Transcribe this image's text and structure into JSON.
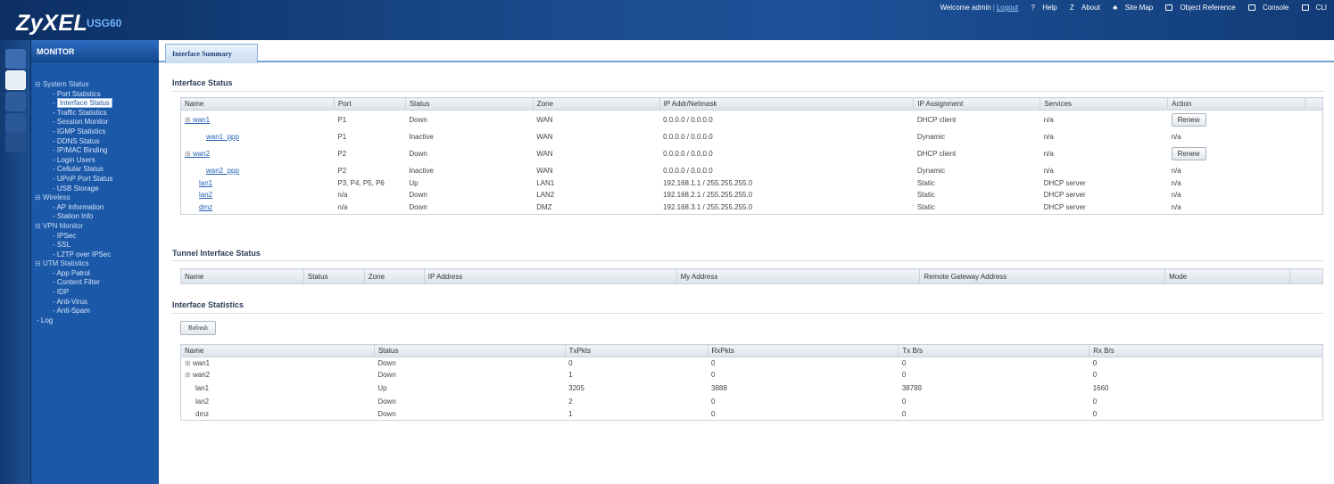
{
  "header": {
    "logo": "ZyXEL",
    "model": "USG60",
    "welcome": "Welcome admin",
    "separator": "|",
    "logout": "Logout",
    "links": [
      "Help",
      "About",
      "Site Map",
      "Object Reference",
      "Console",
      "CLI"
    ]
  },
  "sidebar": {
    "title": "MONITOR",
    "groups": [
      {
        "label": "System Status",
        "items": [
          "Port Statistics",
          "Interface Status",
          "Traffic Statistics",
          "Session Monitor",
          "IGMP Statistics",
          "DDNS Status",
          "IP/MAC Binding",
          "Login Users",
          "Cellular Status",
          "UPnP Port Status",
          "USB Storage"
        ]
      },
      {
        "label": "Wireless",
        "items": [
          "AP Information",
          "Station Info"
        ]
      },
      {
        "label": "VPN Monitor",
        "items": [
          "IPSec",
          "SSL",
          "L2TP over IPSec"
        ]
      },
      {
        "label": "UTM Statistics",
        "items": [
          "App Patrol",
          "Content Filter",
          "IDP",
          "Anti-Virus",
          "Anti-Spam"
        ]
      }
    ],
    "log": "Log"
  },
  "tab": {
    "label": "Interface Summary"
  },
  "interface_status": {
    "title": "Interface Status",
    "columns": [
      "Name",
      "Port",
      "Status",
      "Zone",
      "IP Addr/Netmask",
      "IP Assignment",
      "Services",
      "Action"
    ],
    "rows": [
      {
        "name": "wan1",
        "port": "P1",
        "status": "Down",
        "zone": "WAN",
        "ip": "0.0.0.0 / 0.0.0.0",
        "assign": "DHCP client",
        "services": "n/a",
        "action": "Renew"
      },
      {
        "name": "wan1_ppp",
        "port": "P1",
        "status": "Inactive",
        "zone": "WAN",
        "ip": "0.0.0.0 / 0.0.0.0",
        "assign": "Dynamic",
        "services": "n/a",
        "action": "n/a"
      },
      {
        "name": "wan2",
        "port": "P2",
        "status": "Down",
        "zone": "WAN",
        "ip": "0.0.0.0 / 0.0.0.0",
        "assign": "DHCP client",
        "services": "n/a",
        "action": "Renew"
      },
      {
        "name": "wan2_ppp",
        "port": "P2",
        "status": "Inactive",
        "zone": "WAN",
        "ip": "0.0.0.0 / 0.0.0.0",
        "assign": "Dynamic",
        "services": "n/a",
        "action": "n/a"
      },
      {
        "name": "lan1",
        "port": "P3, P4, P5, P6",
        "status": "Up",
        "zone": "LAN1",
        "ip": "192.168.1.1 / 255.255.255.0",
        "assign": "Static",
        "services": "DHCP server",
        "action": "n/a"
      },
      {
        "name": "lan2",
        "port": "n/a",
        "status": "Down",
        "zone": "LAN2",
        "ip": "192.168.2.1 / 255.255.255.0",
        "assign": "Static",
        "services": "DHCP server",
        "action": "n/a"
      },
      {
        "name": "dmz",
        "port": "n/a",
        "status": "Down",
        "zone": "DMZ",
        "ip": "192.168.3.1 / 255.255.255.0",
        "assign": "Static",
        "services": "DHCP server",
        "action": "n/a"
      }
    ]
  },
  "tunnel_status": {
    "title": "Tunnel Interface Status",
    "columns": [
      "Name",
      "Status",
      "Zone",
      "IP Address",
      "My Address",
      "Remote Gateway Address",
      "Mode"
    ]
  },
  "interface_statistics": {
    "title": "Interface Statistics",
    "refresh": "Refresh",
    "columns": [
      "Name",
      "Status",
      "TxPkts",
      "RxPkts",
      "Tx B/s",
      "Rx B/s"
    ],
    "rows": [
      {
        "name": "wan1",
        "status": "Down",
        "tx": "0",
        "rx": "0",
        "txb": "0",
        "rxb": "0"
      },
      {
        "name": "wan2",
        "status": "Down",
        "tx": "1",
        "rx": "0",
        "txb": "0",
        "rxb": "0"
      },
      {
        "name": "lan1",
        "status": "Up",
        "tx": "3205",
        "rx": "3888",
        "txb": "38789",
        "rxb": "1660"
      },
      {
        "name": "lan2",
        "status": "Down",
        "tx": "2",
        "rx": "0",
        "txb": "0",
        "rxb": "0"
      },
      {
        "name": "dmz",
        "status": "Down",
        "tx": "1",
        "rx": "0",
        "txb": "0",
        "rxb": "0"
      }
    ]
  }
}
